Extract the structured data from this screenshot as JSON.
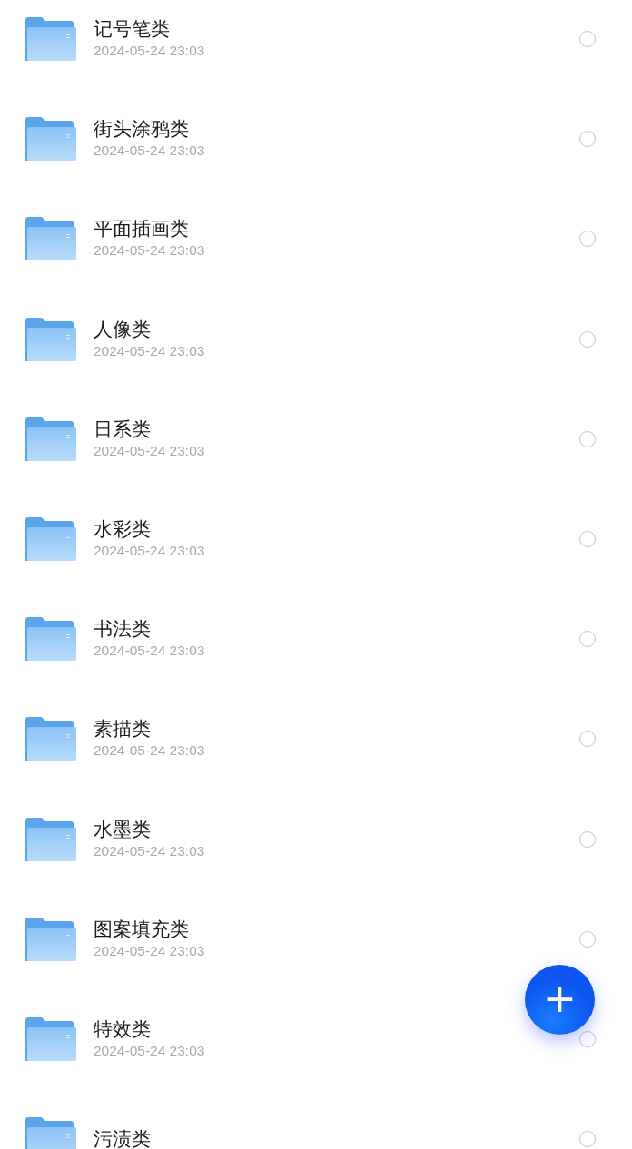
{
  "folders": [
    {
      "name": "记号笔类",
      "date": "2024-05-24 23:03",
      "selected": false
    },
    {
      "name": "街头涂鸦类",
      "date": "2024-05-24 23:03",
      "selected": false
    },
    {
      "name": "平面插画类",
      "date": "2024-05-24 23:03",
      "selected": false
    },
    {
      "name": "人像类",
      "date": "2024-05-24 23:03",
      "selected": false
    },
    {
      "name": "日系类",
      "date": "2024-05-24 23:03",
      "selected": false
    },
    {
      "name": "水彩类",
      "date": "2024-05-24 23:03",
      "selected": false
    },
    {
      "name": "书法类",
      "date": "2024-05-24 23:03",
      "selected": false
    },
    {
      "name": "素描类",
      "date": "2024-05-24 23:03",
      "selected": false
    },
    {
      "name": "水墨类",
      "date": "2024-05-24 23:03",
      "selected": false
    },
    {
      "name": "图案填充类",
      "date": "2024-05-24 23:03",
      "selected": false
    },
    {
      "name": "特效类",
      "date": "2024-05-24 23:03",
      "selected": false
    },
    {
      "name": "污渍类",
      "selected": false
    }
  ],
  "fab": {
    "label": "+"
  }
}
